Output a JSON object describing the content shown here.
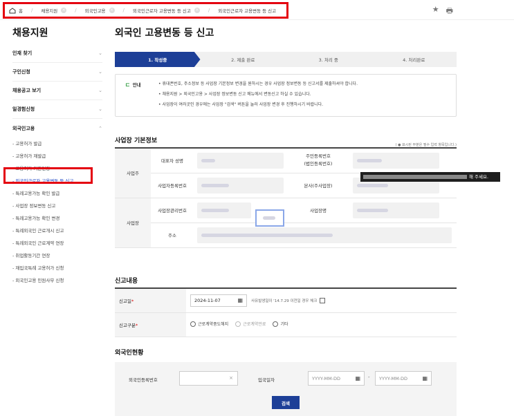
{
  "breadcrumb": [
    {
      "label": "홈",
      "closable": false
    },
    {
      "label": "채용지원",
      "closable": true
    },
    {
      "label": "외국인고용",
      "closable": true
    },
    {
      "label": "외국인근로자 고용변동 등 신고",
      "closable": true
    },
    {
      "label": "외국인근로자 고용변동 등 신고",
      "closable": false
    }
  ],
  "toolbar": {
    "star_icon": "★",
    "print_icon": "🖶"
  },
  "sidebar": {
    "title": "채용지원",
    "groups": [
      {
        "label": "인재 찾기"
      },
      {
        "label": "구인신청"
      },
      {
        "label": "채용공고 보기"
      },
      {
        "label": "일경험신청"
      },
      {
        "label": "외국인고용"
      }
    ],
    "sub_items": [
      "- 고용허가 발급",
      "- 고용허가 재발급",
      "- 고용허가 기간연장",
      "- 외국인근로자 고용변동 등 신고",
      "- 특례고용가능 확인 발급",
      "- 사업장 정보변동 신고",
      "- 특례고용가능 확인 변경",
      "- 특례외국인 근로개시 신고",
      "- 특례외국인 근로계약 연장",
      "- 취업활동기간 연장",
      "- 재입국특례 고용허가 신청",
      "- 외국인고용 민원사무 신청"
    ],
    "chevron": "⌄"
  },
  "page": {
    "title": "외국인 고용변동 등 신고"
  },
  "steps": [
    "1. 작성중",
    "2. 제출 완료",
    "3. 처리 중",
    "4. 처리완료"
  ],
  "notice": {
    "label": "안내",
    "lines": [
      "• 휴대폰번호, 주소정보 등 사업장 기본정보 변경을 원하시는 경우 사업장 정보변동 등 신고서를 제출하셔야 합니다.",
      "• 채용지원 > 외국인고용 > 사업장 정보변동 신고 메뉴에서 변동신고 하실 수 있습니다.",
      "• 사업장이 여러곳인 경우에는 사업장 \"검색\" 버튼을 눌러 사업장 변경 후 진행하시기 바랍니다."
    ]
  },
  "basic_info": {
    "title": "사업장 기본정보",
    "required_note": "( ● 표시된 부분은 필수 입력 항목입니다.)",
    "group_owner": "사업주",
    "group_site": "사업장",
    "fields": {
      "rep_name": "대표자 성명",
      "resident_no": "주민등록번호\n(법인등록번호)",
      "biz_reg_no": "사업자등록번호",
      "hq": "본사(주사업장)",
      "site_mgmt_no": "사업장관리번호",
      "site_name": "사업장명",
      "address": "주소"
    },
    "tooltip_suffix": "해 주세요."
  },
  "report": {
    "title": "신고내용",
    "date_label": "신고일",
    "date_value": "2024-11-07",
    "date_hint": "사유발생일이 '14.7.29 이전일 경우 체크",
    "type_label": "신고구분",
    "options": [
      "근로계약중도해지",
      "근로계약만료",
      "기타"
    ]
  },
  "foreigner": {
    "title": "외국인현황",
    "reg_label": "외국인등록번호",
    "clear": "×",
    "entry_label": "입국일자",
    "date_placeholder": "YYYY-MM-DD",
    "dash": "-",
    "search_button": "검색"
  }
}
